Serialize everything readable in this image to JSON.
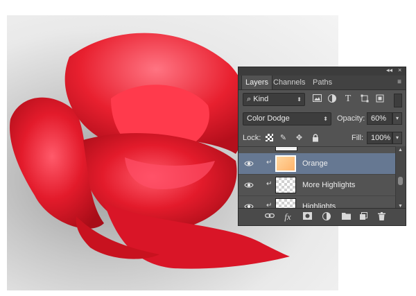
{
  "panel": {
    "tabs": [
      {
        "label": "Layers",
        "active": true
      },
      {
        "label": "Channels",
        "active": false
      },
      {
        "label": "Paths",
        "active": false
      }
    ],
    "collapse_glyph": "◂◂",
    "close_glyph": "×",
    "menu_glyph": "≡",
    "filter": {
      "kind_label": "Kind",
      "icons": [
        "image-filter-icon",
        "adjustment-filter-icon",
        "type-filter-icon",
        "shape-filter-icon",
        "smart-object-filter-icon"
      ],
      "type_glyph": "T"
    },
    "blend_mode": "Color Dodge",
    "opacity_label": "Opacity:",
    "opacity_value": "60%",
    "lock_label": "Lock:",
    "fill_label": "Fill:",
    "fill_value": "100%",
    "layers": [
      {
        "name": "Orange",
        "selected": true,
        "visible": true,
        "clipped": true,
        "thumb": "orange"
      },
      {
        "name": "More Highlights",
        "selected": false,
        "visible": true,
        "clipped": true,
        "thumb": "checker"
      },
      {
        "name": "Highlights",
        "selected": false,
        "visible": true,
        "clipped": true,
        "thumb": "checker"
      }
    ],
    "bottom_icons": [
      "link-layers-icon",
      "layer-style-fx-icon",
      "layer-mask-icon",
      "adjustment-layer-icon",
      "new-group-icon",
      "new-layer-icon",
      "delete-layer-icon"
    ],
    "fx_glyph": "fx"
  },
  "colors": {
    "panel_bg": "#535353",
    "selected_row": "#667892",
    "rose_red": "#e31b2b"
  }
}
